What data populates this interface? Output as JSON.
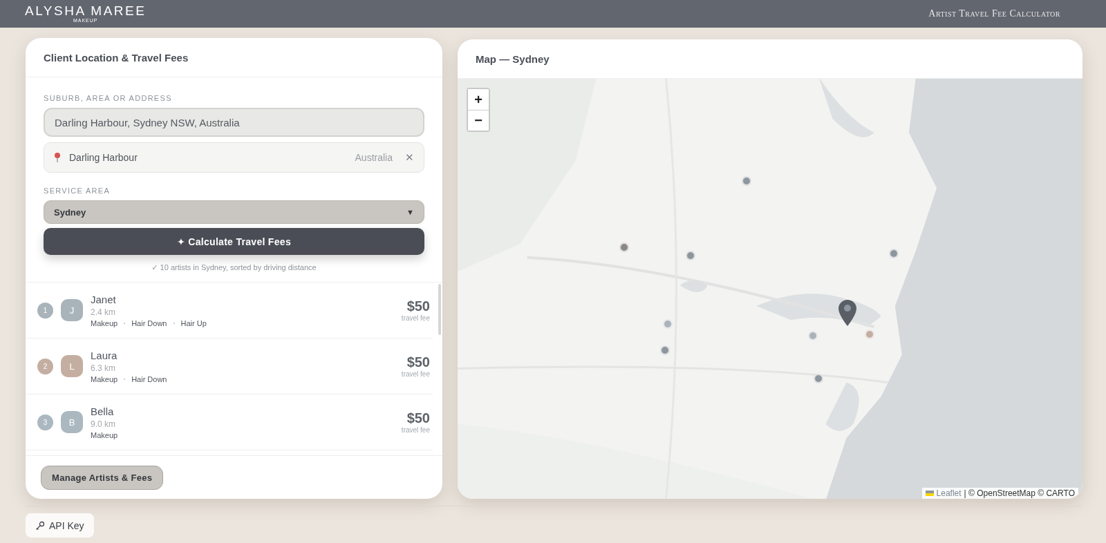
{
  "header": {
    "brand": "ALYSHA MAREE",
    "brand_sub": "MAKEUP",
    "title": "Artist Travel Fee Calculator"
  },
  "form": {
    "title": "Client Location & Travel Fees",
    "address_label": "SUBURB, AREA OR ADDRESS",
    "address_value": "Darling Harbour, Sydney NSW, Australia",
    "suggestion": {
      "name": "Darling Harbour",
      "country": "Australia",
      "clear": "✕"
    },
    "area_label": "SERVICE AREA",
    "area_value": "Sydney",
    "area_caret": "▼",
    "calculate": "✦ Calculate Travel Fees",
    "status": "✓ 10 artists in Sydney, sorted by driving distance"
  },
  "artists": [
    {
      "rank": "1",
      "initial": "J",
      "name": "Janet",
      "distance": "2.4 km",
      "services": [
        "Makeup",
        "Hair Down",
        "Hair Up"
      ],
      "fee": "$50",
      "fee_label": "travel fee",
      "color": "#a9b3ba"
    },
    {
      "rank": "2",
      "initial": "L",
      "name": "Laura",
      "distance": "6.3 km",
      "services": [
        "Makeup",
        "Hair Down"
      ],
      "fee": "$50",
      "fee_label": "travel fee",
      "color": "#c4aea2"
    },
    {
      "rank": "3",
      "initial": "B",
      "name": "Bella",
      "distance": "9.0 km",
      "services": [
        "Makeup"
      ],
      "fee": "$50",
      "fee_label": "travel fee",
      "color": "#abb8c0"
    }
  ],
  "manage_button": "Manage Artists & Fees",
  "map": {
    "title": "Map — Sydney",
    "zoom_in": "+",
    "zoom_out": "−",
    "attribution_link": "Leaflet",
    "attribution": "| © OpenStreetMap © CARTO"
  },
  "api_key_button": "API Key"
}
